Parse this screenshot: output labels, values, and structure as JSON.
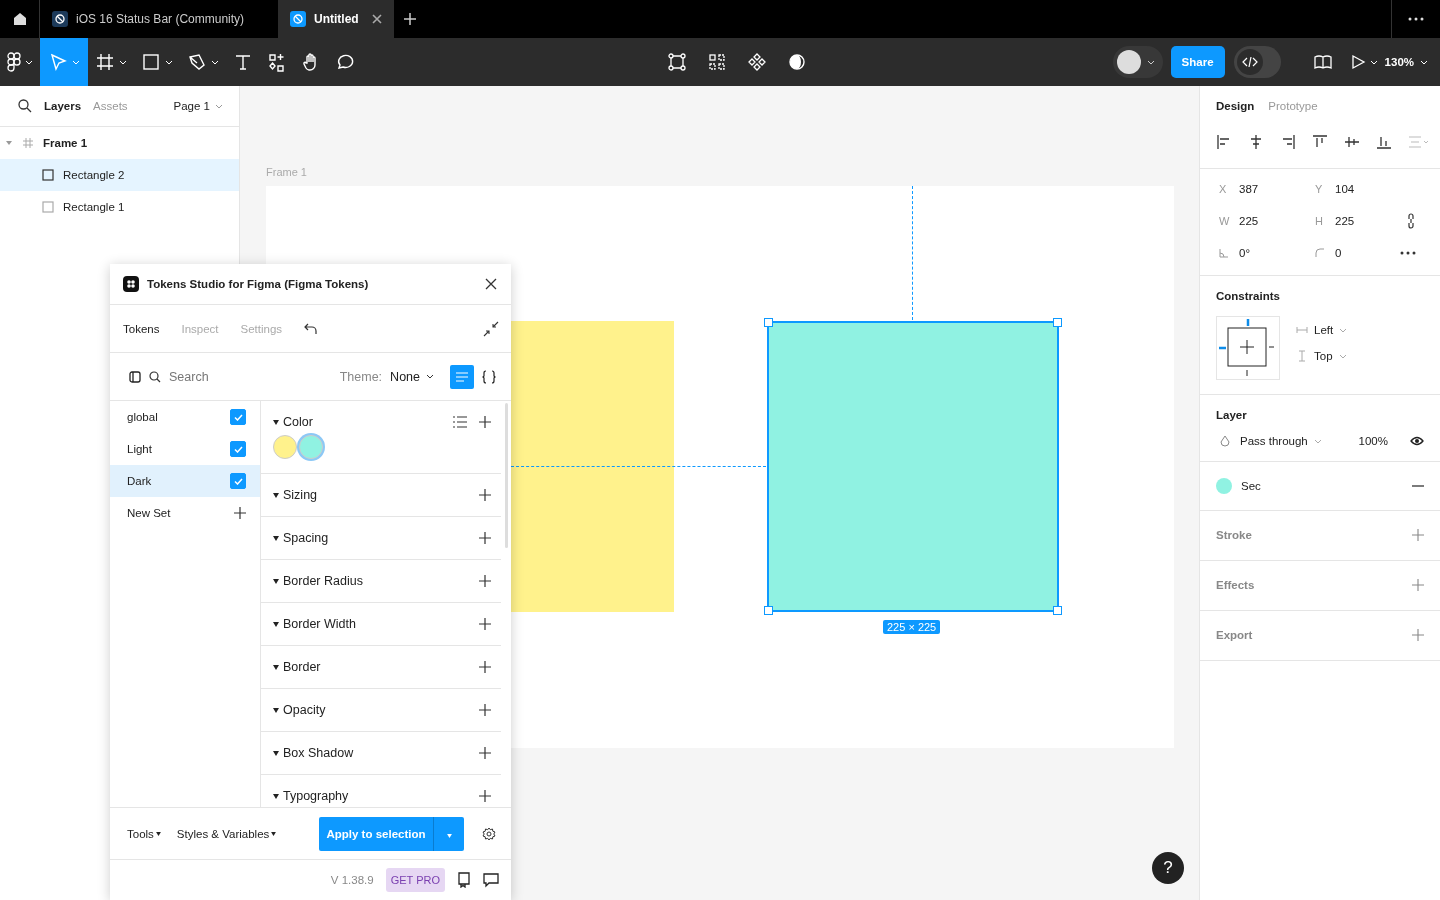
{
  "tabs": [
    {
      "label": "iOS 16 Status Bar (Community)",
      "selected": false
    },
    {
      "label": "Untitled",
      "selected": true
    }
  ],
  "toolbar": {
    "tools": [
      {
        "kind": "move",
        "selected": true
      },
      {
        "kind": "frame",
        "selected": false
      },
      {
        "kind": "rectangle",
        "selected": false
      },
      {
        "kind": "pen",
        "selected": false
      },
      {
        "kind": "text",
        "selected": false
      },
      {
        "kind": "resources",
        "selected": false
      },
      {
        "kind": "hand",
        "selected": false
      },
      {
        "kind": "comment",
        "selected": false
      }
    ],
    "share": "Share",
    "dev_mode": false,
    "zoom": "130%"
  },
  "left_panel": {
    "tabs": [
      {
        "label": "Layers",
        "selected": true
      },
      {
        "label": "Assets",
        "selected": false
      }
    ],
    "page": "Page 1",
    "layers": [
      {
        "name": "Frame 1",
        "kind": "frame",
        "selected": false,
        "expanded": true,
        "children": [
          {
            "name": "Rectangle 2",
            "kind": "rectangle",
            "selected": true
          },
          {
            "name": "Rectangle 1",
            "kind": "rectangle",
            "selected": false
          }
        ]
      }
    ]
  },
  "canvas": {
    "frame_label": "Frame 1",
    "size_label": "225 × 225",
    "shapes": [
      {
        "color": "#fff28c",
        "selected": false
      },
      {
        "color": "#90f2e2",
        "selected": true
      }
    ]
  },
  "plugin": {
    "title": "Tokens Studio for Figma (Figma Tokens)",
    "tabs": [
      {
        "label": "Tokens",
        "selected": true
      },
      {
        "label": "Inspect",
        "selected": false
      },
      {
        "label": "Settings",
        "selected": false
      }
    ],
    "search": {
      "placeholder": "Search"
    },
    "theme_label": "Theme:",
    "theme": "None",
    "sets": [
      {
        "name": "global",
        "checked": true,
        "selected": false
      },
      {
        "name": "Light",
        "checked": true,
        "selected": false
      },
      {
        "name": "Dark",
        "checked": true,
        "selected": true
      }
    ],
    "new_set": "New Set",
    "groups": [
      {
        "name": "Color",
        "swatches": [
          {
            "color": "#fff28c",
            "selected": false
          },
          {
            "color": "#90f2e2",
            "selected": true
          }
        ]
      },
      {
        "name": "Sizing"
      },
      {
        "name": "Spacing"
      },
      {
        "name": "Border Radius"
      },
      {
        "name": "Border Width"
      },
      {
        "name": "Border"
      },
      {
        "name": "Opacity"
      },
      {
        "name": "Box Shadow"
      },
      {
        "name": "Typography"
      }
    ],
    "tools": "Tools",
    "styles": "Styles & Variables",
    "apply": "Apply to selection",
    "version": "V 1.38.9",
    "get_pro": "GET PRO"
  },
  "design_panel": {
    "tabs": [
      {
        "label": "Design",
        "selected": true
      },
      {
        "label": "Prototype",
        "selected": false
      }
    ],
    "fields": [
      {
        "kind": "text",
        "label": "X",
        "value": "387"
      },
      {
        "kind": "text",
        "label": "Y",
        "value": "104"
      },
      {
        "kind": "text",
        "label": "W",
        "value": "225"
      },
      {
        "kind": "text",
        "label": "H",
        "value": "225"
      },
      {
        "kind": "angle",
        "value": "0°"
      },
      {
        "kind": "radius",
        "value": "0"
      }
    ],
    "constraints": {
      "title": "Constraints",
      "horizontal": "Left",
      "vertical": "Top"
    },
    "layer": {
      "title": "Layer",
      "blend": "Pass through",
      "opacity": "100%"
    },
    "fill": {
      "name": "Sec",
      "color": "#90f2e2"
    },
    "sections": [
      "Stroke",
      "Effects",
      "Export"
    ]
  },
  "help": "?"
}
